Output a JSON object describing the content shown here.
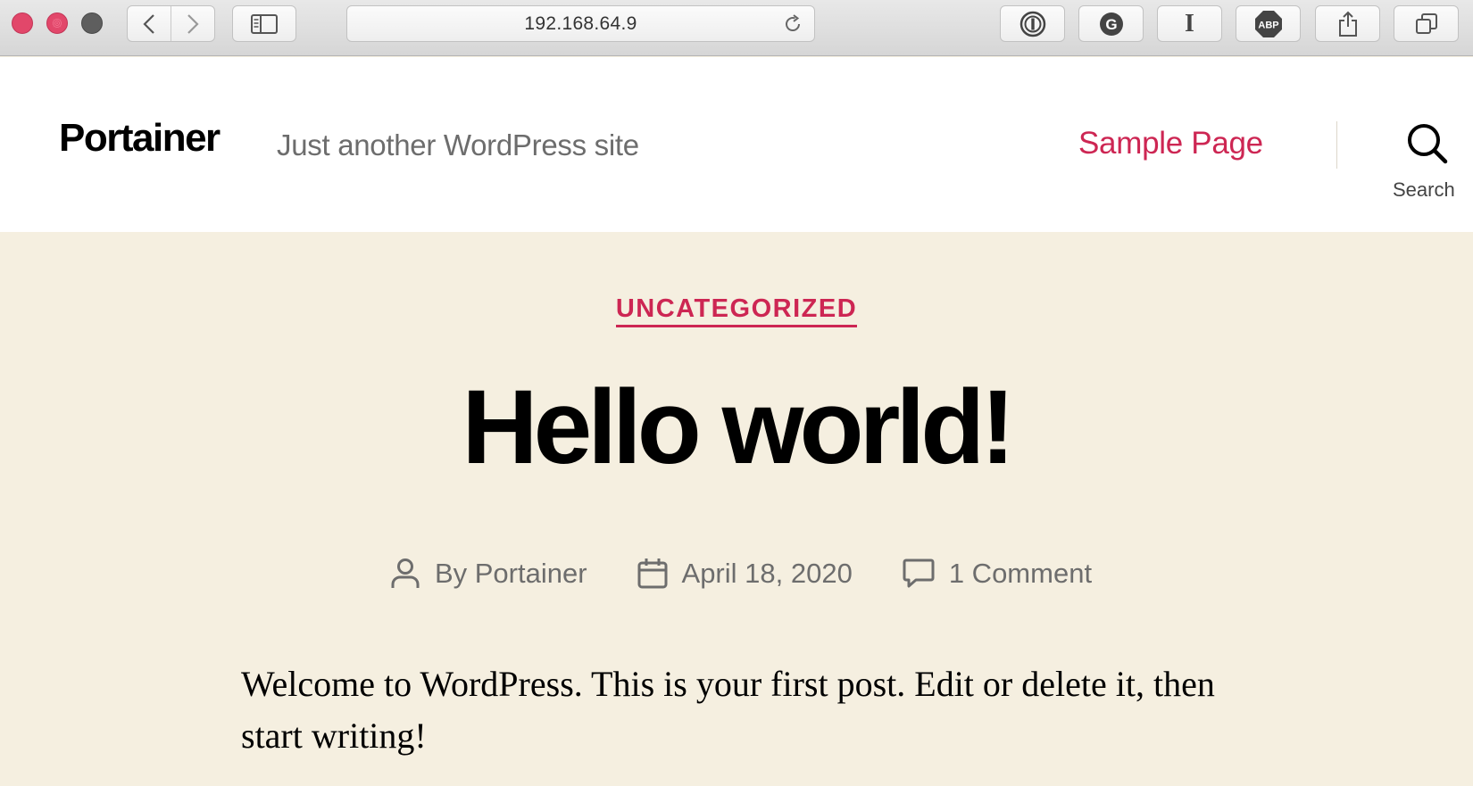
{
  "browser": {
    "url": "192.168.64.9",
    "extensions": [
      "1password-icon",
      "grammarly-icon",
      "instapaper-icon",
      "adblock-plus-icon",
      "share-icon",
      "tabs-icon"
    ],
    "abp_label": "ABP",
    "grammarly_label": "G",
    "instapaper_label": "I"
  },
  "header": {
    "site_title": "Portainer",
    "site_description": "Just another WordPress site",
    "menu": [
      {
        "label": "Sample Page"
      }
    ],
    "search_label": "Search"
  },
  "post": {
    "category": "UNCATEGORIZED",
    "title": "Hello world!",
    "author": "By Portainer",
    "date": "April 18, 2020",
    "comments": "1 Comment",
    "content": "Welcome to WordPress. This is your first post. Edit or delete it, then start writing!"
  },
  "colors": {
    "accent": "#cd2653",
    "background": "#f5efe0",
    "header_bg": "#ffffff",
    "meta_text": "#6d6d6d"
  }
}
